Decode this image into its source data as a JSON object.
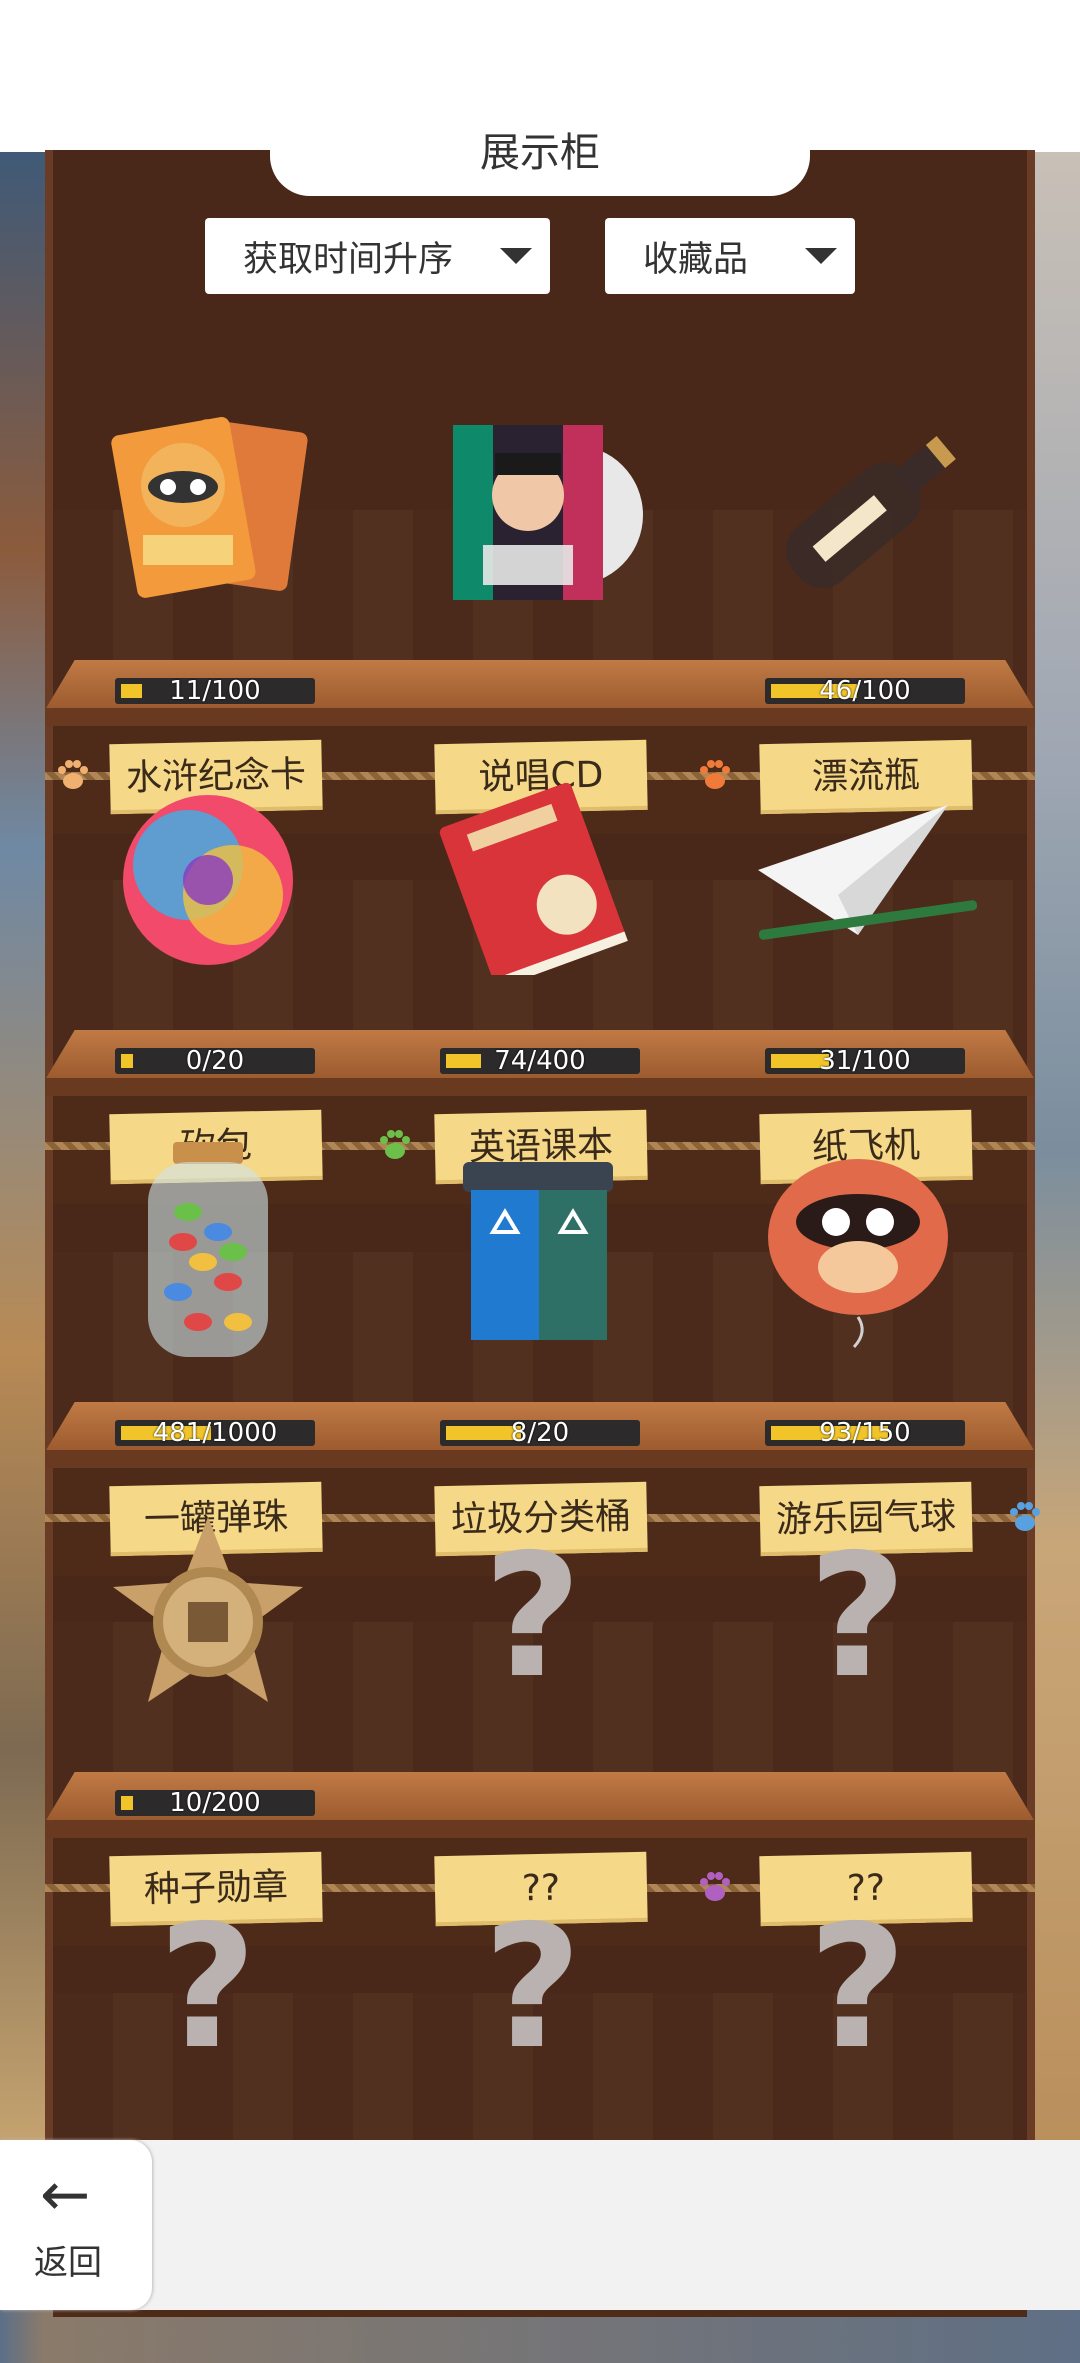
{
  "header": {
    "title": "展示柜"
  },
  "filters": {
    "sort": "获取时间升序",
    "category": "收藏品"
  },
  "rows": [
    {
      "items": [
        {
          "name": "水浒纪念卡",
          "progress_text": "11/100",
          "progress": 0.11,
          "icon": "card-icon"
        },
        {
          "name": "说唱CD",
          "progress_text": "",
          "progress": 0,
          "icon": "cd-icon"
        },
        {
          "name": "漂流瓶",
          "progress_text": "46/100",
          "progress": 0.46,
          "icon": "bottle-icon"
        }
      ]
    },
    {
      "items": [
        {
          "name": "砍包",
          "progress_text": "0/20",
          "progress": 0,
          "icon": "pompom-icon"
        },
        {
          "name": "英语课本",
          "progress_text": "74/400",
          "progress": 0.185,
          "icon": "book-icon"
        },
        {
          "name": "纸飞机",
          "progress_text": "31/100",
          "progress": 0.31,
          "icon": "paper-plane-icon"
        }
      ]
    },
    {
      "items": [
        {
          "name": "一罐弹珠",
          "progress_text": "481/1000",
          "progress": 0.481,
          "icon": "jar-icon"
        },
        {
          "name": "垃圾分类桶",
          "progress_text": "8/20",
          "progress": 0.4,
          "icon": "trash-bin-icon"
        },
        {
          "name": "游乐园气球",
          "progress_text": "93/150",
          "progress": 0.62,
          "icon": "balloon-icon"
        }
      ]
    },
    {
      "items": [
        {
          "name": "种子勋章",
          "progress_text": "10/200",
          "progress": 0.05,
          "icon": "medal-icon"
        },
        {
          "name": "??",
          "progress_text": "",
          "progress": 0,
          "icon": "question-icon"
        },
        {
          "name": "??",
          "progress_text": "",
          "progress": 0,
          "icon": "question-icon"
        }
      ]
    },
    {
      "items": [
        {
          "name": "??",
          "progress_text": "",
          "progress": 0,
          "icon": "question-icon"
        },
        {
          "name": "??",
          "progress_text": "",
          "progress": 0,
          "icon": "question-icon"
        },
        {
          "name": "??",
          "progress_text": "",
          "progress": 0,
          "icon": "question-icon"
        }
      ]
    }
  ],
  "question_glyph": "?",
  "footer": {
    "back_label": "返回",
    "back_arrow": "←"
  },
  "colors": {
    "wood_dark": "#4a2819",
    "label_bg": "#f6d889",
    "progress_fill": "#f1c52a"
  }
}
